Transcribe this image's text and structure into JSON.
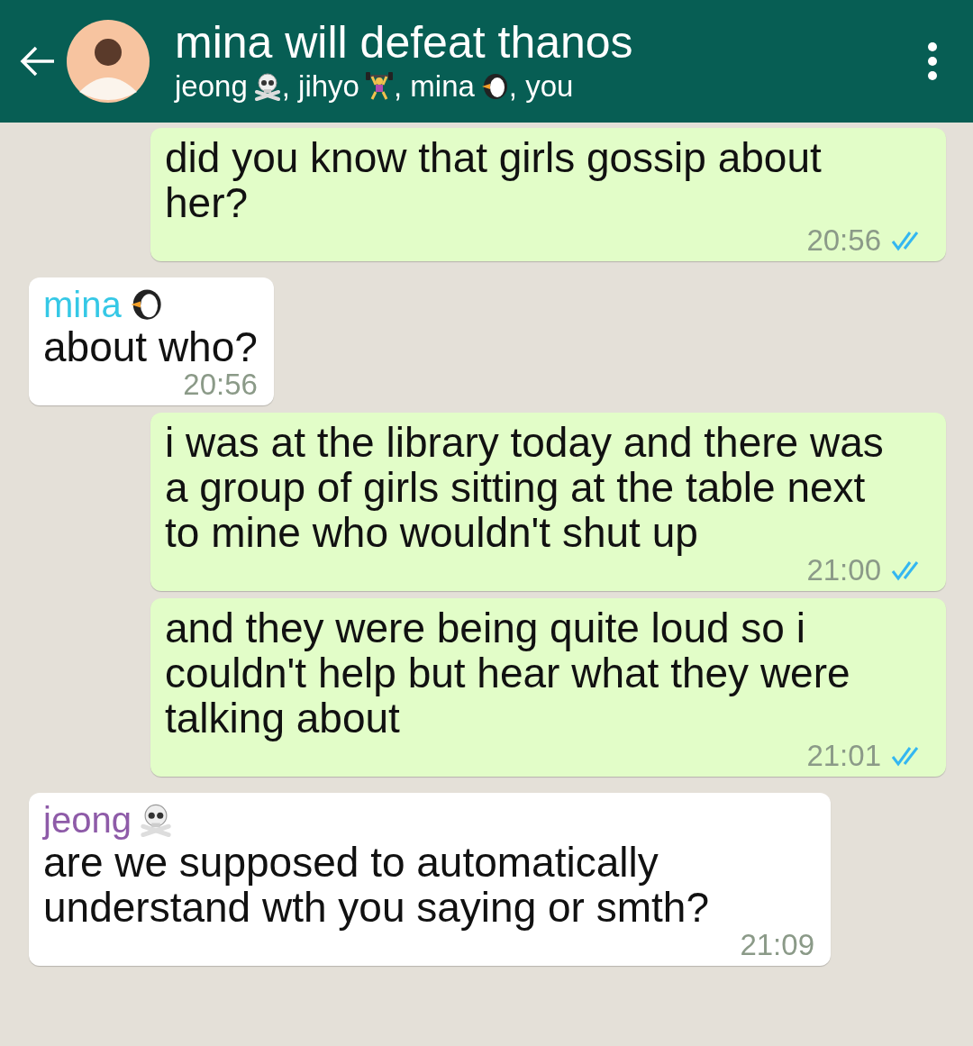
{
  "header": {
    "title": "mina will defeat thanos",
    "members": [
      {
        "name": "jeong",
        "kind": "skull"
      },
      {
        "name": ", jihyo",
        "kind": "lifter"
      },
      {
        "name": ", mina",
        "kind": "penguin"
      },
      {
        "name": ", you"
      }
    ]
  },
  "messages": [
    {
      "kind": "out",
      "text": "did you know that girls gossip about her?",
      "time": "20:56",
      "read": true
    },
    {
      "kind": "in",
      "sender": {
        "name": "mina",
        "kind": "penguin",
        "color": "#35c8e6"
      },
      "text": "about who?",
      "time": "20:56"
    },
    {
      "kind": "out",
      "text": "i was at the library today and there was a group of girls sitting at the table next to mine who wouldn't shut up",
      "time": "21:00",
      "read": true
    },
    {
      "kind": "out",
      "text": "and they were being quite loud so i couldn't help but hear what they were talking about",
      "time": "21:01",
      "read": true
    },
    {
      "kind": "in",
      "sender": {
        "name": "jeong",
        "kind": "skull",
        "color": "#8e5ba8"
      },
      "text": "are we supposed to automatically understand wth you saying or smth?",
      "time": "21:09"
    }
  ]
}
